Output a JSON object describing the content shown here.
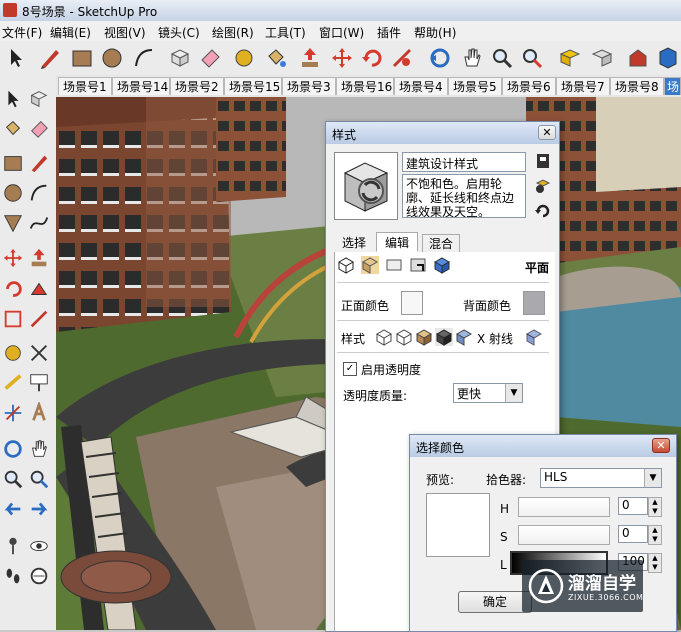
{
  "window": {
    "title": "8号场景 - SketchUp Pro"
  },
  "menu": [
    "文件(F)",
    "编辑(E)",
    "视图(V)",
    "镜头(C)",
    "绘图(R)",
    "工具(T)",
    "窗口(W)",
    "插件",
    "帮助(H)"
  ],
  "scene_tabs": [
    "场景号1",
    "场景号14",
    "场景号2",
    "场景号15",
    "场景号3",
    "场景号16",
    "场景号4",
    "场景号5",
    "场景号6",
    "场景号7",
    "场景号8",
    "场"
  ],
  "styles_dialog": {
    "title": "样式",
    "style_name": "建筑设计样式",
    "style_desc": "不饱和色。启用轮廓、延长线和终点边线效果及天空。",
    "tabs": [
      "选择",
      "编辑",
      "混合"
    ],
    "section_label": "平面",
    "front_color_label": "正面颜色",
    "back_color_label": "背面颜色",
    "style_label": "样式",
    "xray_label": "X 射线",
    "transparency_checkbox": "启用透明度",
    "transparency_checked": true,
    "quality_label": "透明度质量:",
    "quality_value": "更快",
    "front_color": "#f7f7f7",
    "back_color": "#a9a9ae"
  },
  "color_dialog": {
    "title": "选择颜色",
    "preview_label": "预览:",
    "picker_label": "拾色器:",
    "picker_value": "HLS",
    "h_label": "H",
    "s_label": "S",
    "l_label": "L",
    "h_value": "0",
    "s_value": "0",
    "l_value": "100",
    "ok_label": "确定"
  },
  "watermark": {
    "brand": "溜溜自学",
    "url": "ZIXUE.3066.COM"
  }
}
